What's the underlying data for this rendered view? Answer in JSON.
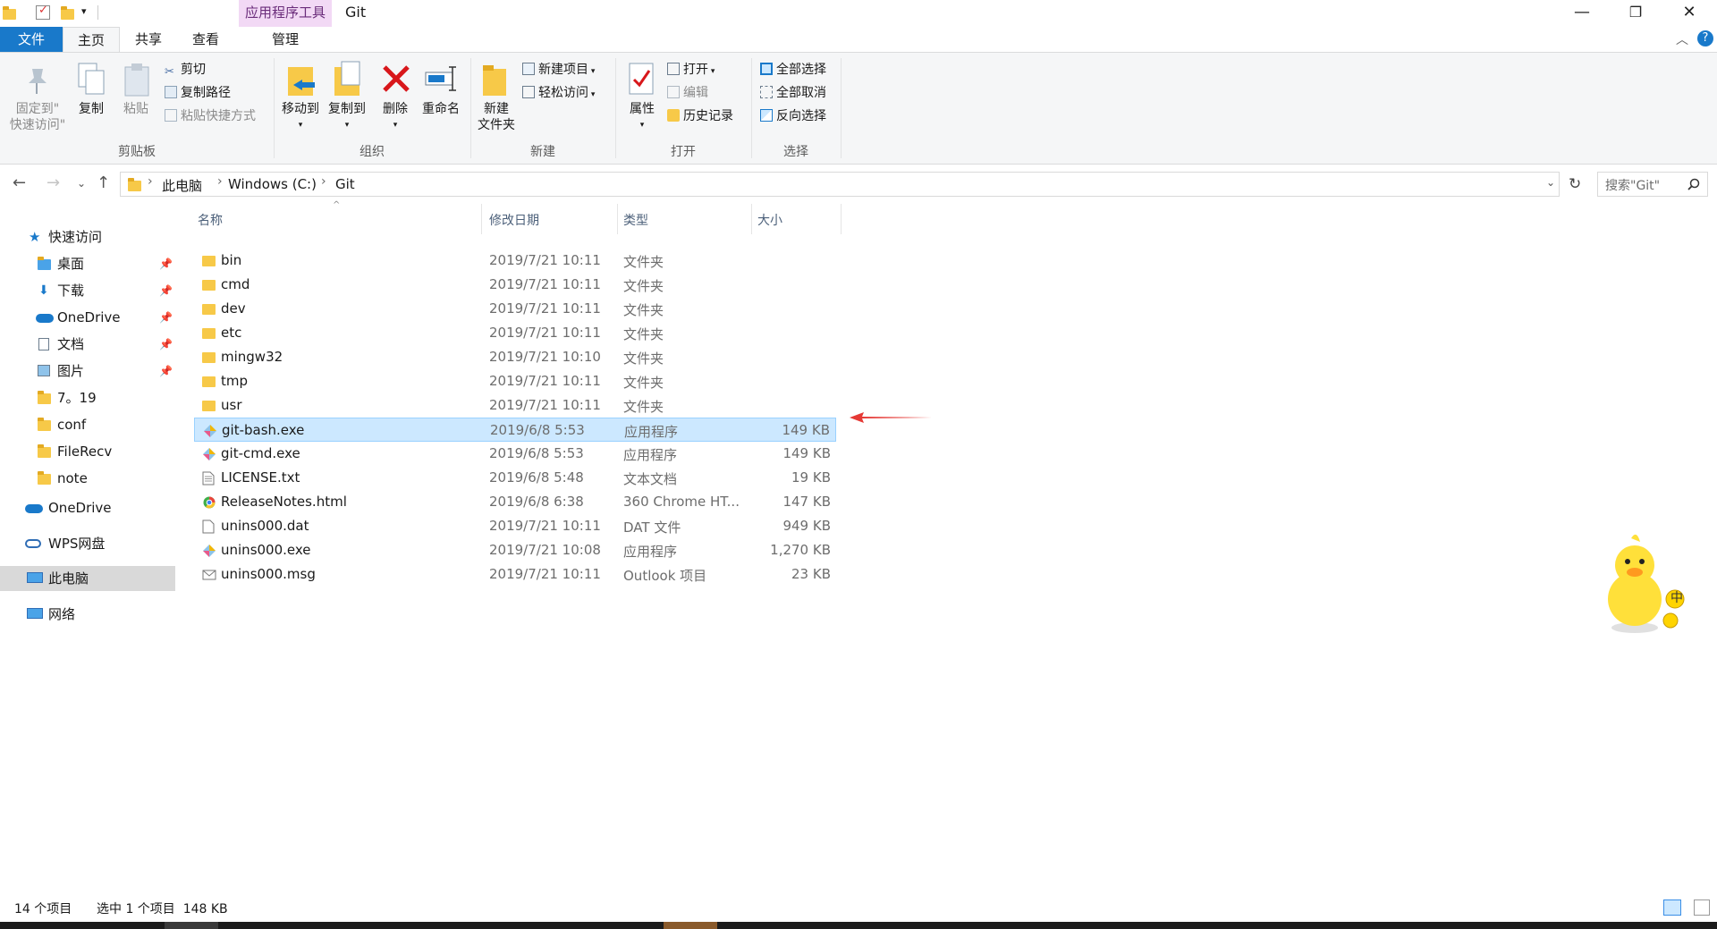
{
  "titlebar": {
    "context_tools_label": "应用程序工具",
    "window_title": "Git",
    "min_glyph": "—",
    "max_glyph": "❐",
    "close_glyph": "✕"
  },
  "tabs": {
    "file": "文件",
    "home": "主页",
    "share": "共享",
    "view": "查看",
    "manage": "管理"
  },
  "ribbon": {
    "clipboard": {
      "group_label": "剪贴板",
      "pin_label_line1": "固定到\"",
      "pin_label_line2": "快速访问\"",
      "copy_label": "复制",
      "paste_label": "粘贴",
      "cut_label": "剪切",
      "copy_path_label": "复制路径",
      "paste_shortcut_label": "粘贴快捷方式"
    },
    "organize": {
      "group_label": "组织",
      "move_to_label": "移动到",
      "copy_to_label": "复制到",
      "delete_label": "删除",
      "rename_label": "重命名"
    },
    "new": {
      "group_label": "新建",
      "new_folder_line1": "新建",
      "new_folder_line2": "文件夹",
      "new_item_label": "新建项目",
      "easy_access_label": "轻松访问"
    },
    "open": {
      "group_label": "打开",
      "properties_label": "属性",
      "open_label": "打开",
      "edit_label": "编辑",
      "history_label": "历史记录"
    },
    "select": {
      "group_label": "选择",
      "select_all_label": "全部选择",
      "select_none_label": "全部取消",
      "invert_label": "反向选择"
    }
  },
  "address": {
    "crumbs": [
      "此电脑",
      "Windows (C:)",
      "Git"
    ],
    "search_placeholder": "搜索\"Git\""
  },
  "navpane": {
    "quick_access": "快速访问",
    "items": [
      {
        "label": "桌面",
        "pinned": true
      },
      {
        "label": "下载",
        "pinned": true
      },
      {
        "label": "OneDrive",
        "pinned": true
      },
      {
        "label": "文档",
        "pinned": true
      },
      {
        "label": "图片",
        "pinned": true
      },
      {
        "label": "7。19",
        "pinned": false
      },
      {
        "label": "conf",
        "pinned": false
      },
      {
        "label": "FileRecv",
        "pinned": false
      },
      {
        "label": "note",
        "pinned": false
      }
    ],
    "onedrive": "OneDrive",
    "wps": "WPS网盘",
    "this_pc": "此电脑",
    "network": "网络"
  },
  "columns": {
    "name": "名称",
    "date": "修改日期",
    "type": "类型",
    "size": "大小"
  },
  "files": [
    {
      "name": "bin",
      "date": "2019/7/21 10:11",
      "type": "文件夹",
      "size": "",
      "icon": "folder-icon"
    },
    {
      "name": "cmd",
      "date": "2019/7/21 10:11",
      "type": "文件夹",
      "size": "",
      "icon": "folder-icon"
    },
    {
      "name": "dev",
      "date": "2019/7/21 10:11",
      "type": "文件夹",
      "size": "",
      "icon": "folder-icon"
    },
    {
      "name": "etc",
      "date": "2019/7/21 10:11",
      "type": "文件夹",
      "size": "",
      "icon": "folder-icon"
    },
    {
      "name": "mingw32",
      "date": "2019/7/21 10:10",
      "type": "文件夹",
      "size": "",
      "icon": "folder-icon"
    },
    {
      "name": "tmp",
      "date": "2019/7/21 10:11",
      "type": "文件夹",
      "size": "",
      "icon": "folder-icon"
    },
    {
      "name": "usr",
      "date": "2019/7/21 10:11",
      "type": "文件夹",
      "size": "",
      "icon": "folder-icon"
    },
    {
      "name": "git-bash.exe",
      "date": "2019/6/8 5:53",
      "type": "应用程序",
      "size": "149 KB",
      "icon": "git-app-icon",
      "selected": true
    },
    {
      "name": "git-cmd.exe",
      "date": "2019/6/8 5:53",
      "type": "应用程序",
      "size": "149 KB",
      "icon": "git-app-icon"
    },
    {
      "name": "LICENSE.txt",
      "date": "2019/6/8 5:48",
      "type": "文本文档",
      "size": "19 KB",
      "icon": "text-file-icon"
    },
    {
      "name": "ReleaseNotes.html",
      "date": "2019/6/8 6:38",
      "type": "360 Chrome HT...",
      "size": "147 KB",
      "icon": "browser-file-icon"
    },
    {
      "name": "unins000.dat",
      "date": "2019/7/21 10:11",
      "type": "DAT 文件",
      "size": "949 KB",
      "icon": "blank-file-icon"
    },
    {
      "name": "unins000.exe",
      "date": "2019/7/21 10:08",
      "type": "应用程序",
      "size": "1,270 KB",
      "icon": "git-app-icon"
    },
    {
      "name": "unins000.msg",
      "date": "2019/7/21 10:11",
      "type": "Outlook 项目",
      "size": "23 KB",
      "icon": "mail-file-icon"
    }
  ],
  "status": {
    "item_count": "14 个项目",
    "selection": "选中 1 个项目  148 KB"
  },
  "overlay": {
    "ime_badge": "中"
  },
  "colors": {
    "accent": "#1979ca",
    "selection_bg": "#cce8ff",
    "arrow": "#e53935"
  }
}
